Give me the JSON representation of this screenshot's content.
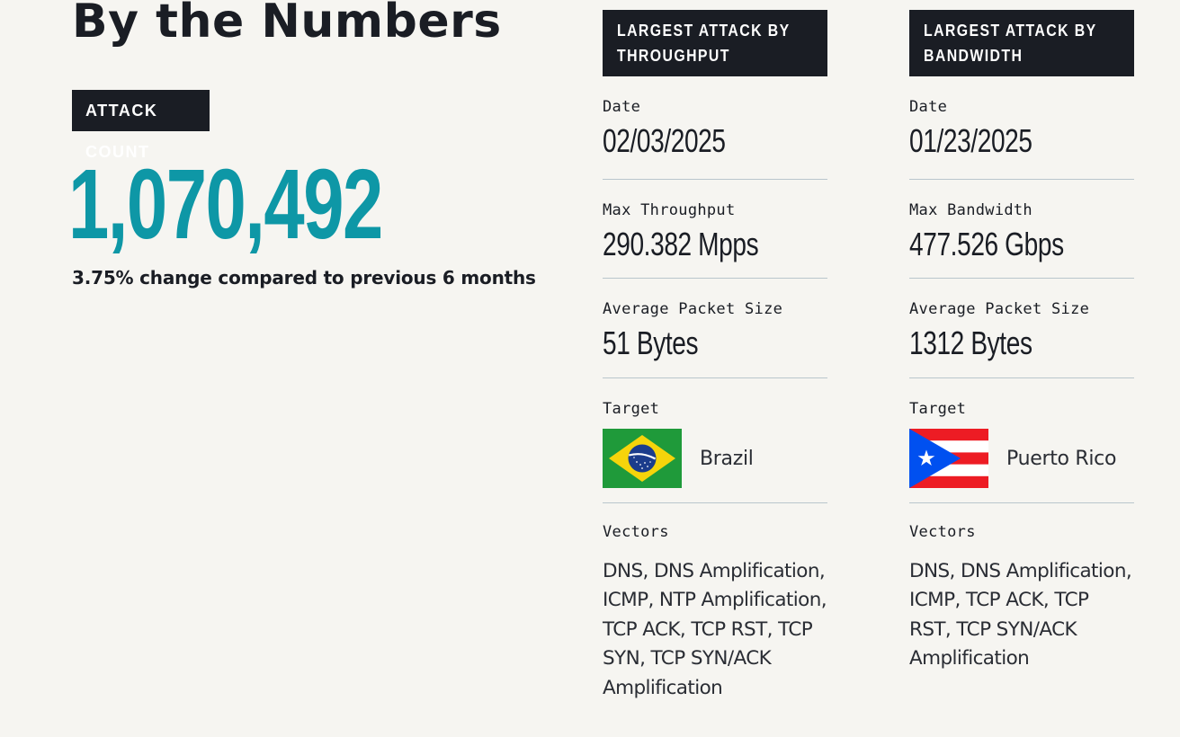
{
  "page": {
    "title": "By the Numbers"
  },
  "attack_count": {
    "tag": "ATTACK COUNT",
    "value": "1,070,492",
    "change": "3.75% change compared to previous 6 months"
  },
  "throughput": {
    "heading_line1": "LARGEST ATTACK BY",
    "heading_line2": "THROUGHPUT",
    "date_label": "Date",
    "date_value": "02/03/2025",
    "max_label": "Max Throughput",
    "max_value": "290.382 Mpps",
    "avg_label": "Average Packet Size",
    "avg_value": "51 Bytes",
    "target_label": "Target",
    "target_country": "Brazil",
    "target_flag_icon": "brazil-flag-icon",
    "vectors_label": "Vectors",
    "vectors_value": "DNS, DNS Amplification, ICMP, NTP Amplification, TCP ACK, TCP RST, TCP SYN, TCP SYN/ACK Amplification"
  },
  "bandwidth": {
    "heading_line1": "LARGEST ATTACK BY",
    "heading_line2": "BANDWIDTH",
    "date_label": "Date",
    "date_value": "01/23/2025",
    "max_label": "Max Bandwidth",
    "max_value": "477.526 Gbps",
    "avg_label": "Average Packet Size",
    "avg_value": "1312 Bytes",
    "target_label": "Target",
    "target_country": "Puerto Rico",
    "target_flag_icon": "puerto-rico-flag-icon",
    "vectors_label": "Vectors",
    "vectors_value": "DNS, DNS Amplification, ICMP, TCP ACK, TCP RST, TCP SYN/ACK Amplification"
  },
  "colors": {
    "accent": "#0e97a6",
    "dark": "#1a1d24",
    "background": "#f6f5f1",
    "divider": "#b9c6cc"
  }
}
